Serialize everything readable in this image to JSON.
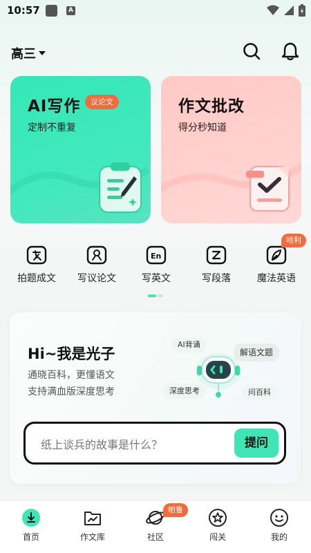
{
  "status_bar": {
    "time": "10:57",
    "notice_badge": "A"
  },
  "header": {
    "grade": "高三"
  },
  "cards": {
    "ai_write": {
      "title": "AI写作",
      "tag": "议论文",
      "subtitle": "定制不重复"
    },
    "correction": {
      "title": "作文批改",
      "subtitle": "得分秒知道"
    }
  },
  "tools": [
    {
      "label": "拍题成文",
      "icon": "photo-text-icon"
    },
    {
      "label": "写议论文",
      "icon": "argument-icon"
    },
    {
      "label": "写英文",
      "icon": "english-icon"
    },
    {
      "label": "写段落",
      "icon": "paragraph-icon"
    },
    {
      "label": "魔法英语",
      "icon": "magic-english-icon"
    }
  ],
  "tools_hot_badge": "哈利",
  "assistant": {
    "greeting": "Hi~我是光子",
    "line1": "通晓百科，更懂语文",
    "line2": "支持满血版深度思考",
    "bubbles": {
      "ai_recite": "AI背诵",
      "explain": "解语文题",
      "deep_think": "深度思考",
      "ask_wiki": "问百科"
    },
    "input_placeholder": "纸上谈兵的故事是什么？",
    "ask_button": "提问"
  },
  "nav": {
    "items": [
      {
        "label": "首页",
        "icon": "home-icon"
      },
      {
        "label": "作文库",
        "icon": "essay-library-icon"
      },
      {
        "label": "社区",
        "icon": "community-icon"
      },
      {
        "label": "闯关",
        "icon": "challenge-icon"
      },
      {
        "label": "我的",
        "icon": "profile-icon"
      }
    ],
    "community_badge": "帕鲁"
  },
  "colors": {
    "accent_green": "#3fe6b5",
    "accent_pink": "#ffcdc9",
    "badge_orange": "#f46a3a"
  }
}
